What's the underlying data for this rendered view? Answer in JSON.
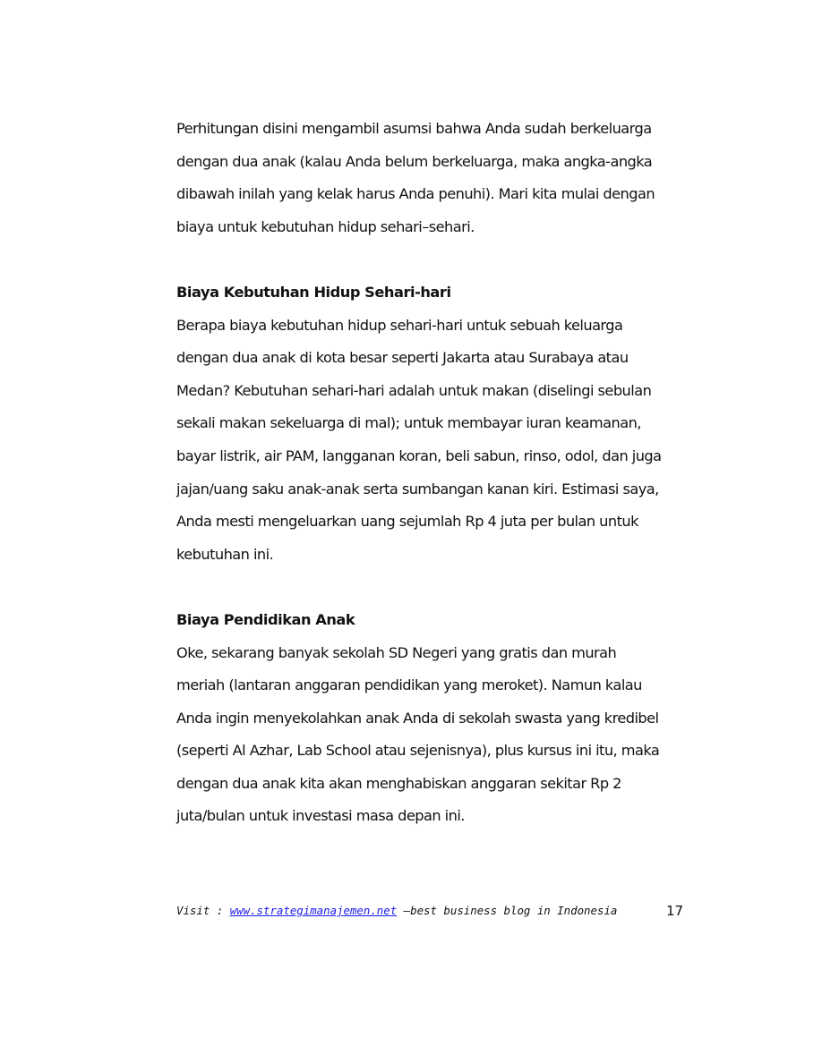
{
  "intro": {
    "lines": [
      "Perhitungan disini mengambil asumsi bahwa Anda sudah berkeluarga",
      "dengan dua anak (kalau Anda belum berkeluarga, maka angka-angka",
      "dibawah inilah yang kelak harus Anda penuhi). Mari kita mulai dengan",
      "biaya untuk kebutuhan hidup sehari–sehari."
    ]
  },
  "section1": {
    "heading": "Biaya Kebutuhan Hidup Sehari-hari",
    "lines": [
      "Berapa biaya kebutuhan hidup sehari-hari untuk sebuah keluarga",
      "dengan dua anak di kota besar seperti Jakarta atau Surabaya atau",
      "Medan? Kebutuhan sehari-hari adalah untuk makan (diselingi sebulan",
      "sekali makan sekeluarga di mal); untuk membayar iuran keamanan,",
      "bayar listrik, air PAM, langganan koran, beli sabun, rinso, odol, dan juga",
      "jajan/uang saku anak-anak serta sumbangan kanan kiri. Estimasi saya,",
      "Anda mesti mengeluarkan uang sejumlah Rp 4 juta per bulan untuk",
      "kebutuhan ini."
    ]
  },
  "section2": {
    "heading": "Biaya Pendidikan Anak",
    "lines": [
      "Oke, sekarang banyak sekolah SD Negeri yang gratis dan murah",
      "meriah (lantaran anggaran pendidikan yang meroket). Namun kalau",
      "Anda ingin menyekolahkan anak Anda di sekolah swasta yang kredibel",
      "(seperti Al Azhar, Lab School atau sejenisnya), plus kursus ini itu, maka",
      "dengan dua anak kita akan menghabiskan anggaran sekitar Rp 2",
      "juta/bulan untuk investasi masa depan ini."
    ]
  },
  "footer": {
    "prefix": "Visit : ",
    "link_text": "www.strategimanajemen.net",
    "suffix": " –best business blog in Indonesia",
    "page_number": "17",
    "link_color": "#1a1aee"
  }
}
